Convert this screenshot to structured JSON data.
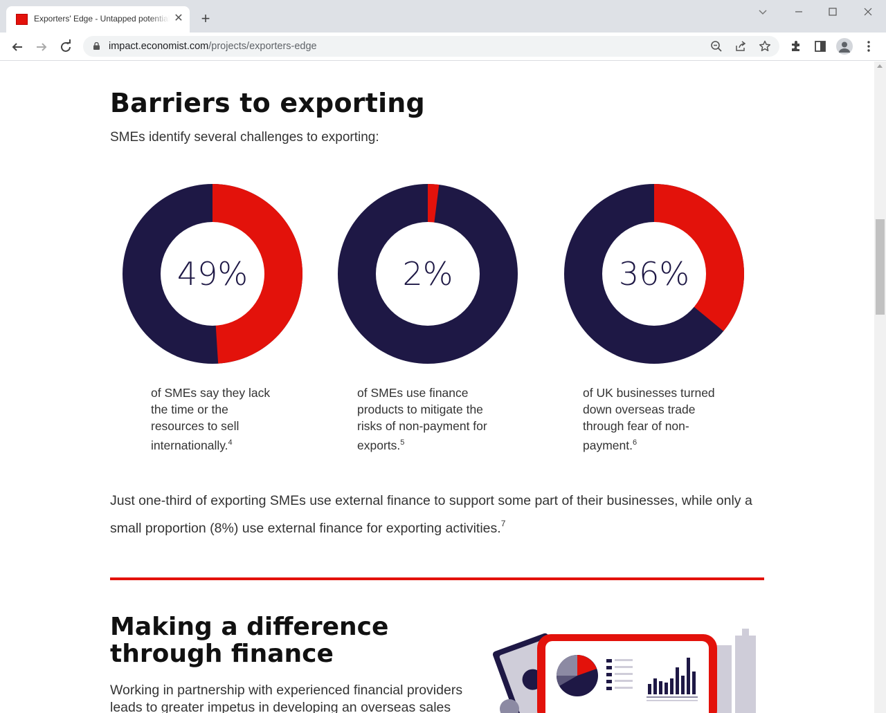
{
  "browser": {
    "tab_title": "Exporters' Edge - Untapped potential",
    "url_host": "impact.economist.com",
    "url_path": "/projects/exporters-edge"
  },
  "page": {
    "heading": "Barriers to exporting",
    "intro": "SMEs identify several challenges to exporting:",
    "stats": [
      {
        "value": "49%",
        "fraction": 0.49,
        "caption": "of SMEs say they lack the time or the resources to sell internationally.",
        "footnote": "4"
      },
      {
        "value": "2%",
        "fraction": 0.02,
        "caption": "of SMEs use finance products to mitigate the risks of non-payment for exports.",
        "footnote": "5"
      },
      {
        "value": "36%",
        "fraction": 0.36,
        "caption": "of UK businesses turned down overseas trade through fear of non-payment.",
        "footnote": "6"
      }
    ],
    "paragraph": "Just one-third of exporting SMEs use external finance to support some part of their businesses, while only a small proportion (8%) use external finance for exporting activities.",
    "paragraph_footnote": "7",
    "section2_heading_line1": "Making a difference",
    "section2_heading_line2": "through finance",
    "section2_para": "Working in partnership with experienced financial providers leads to greater impetus in developing an overseas sales"
  },
  "colors": {
    "accent": "#e3120b",
    "navy": "#1e1845"
  },
  "icons": [
    "back-arrow-icon",
    "forward-arrow-icon",
    "reload-icon",
    "lock-icon",
    "zoom-out-icon",
    "share-icon",
    "star-icon",
    "extensions-icon",
    "side-panel-icon",
    "profile-icon",
    "more-menu-icon"
  ]
}
